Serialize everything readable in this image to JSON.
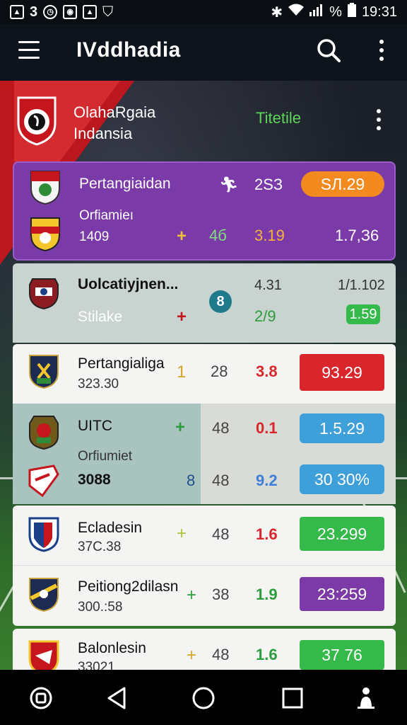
{
  "status_bar": {
    "left_icons": [
      "photo-icon",
      "3",
      "clock-icon",
      "camera-icon",
      "photo-icon",
      "shield-icon"
    ],
    "battery_text": "%",
    "time": "19:31"
  },
  "app_bar": {
    "title": "IVddhadia"
  },
  "league": {
    "name_line1": "OlahaRgaia",
    "name_line2": "Indansia",
    "action": "Titetile"
  },
  "matches": [
    {
      "team1": "Pertangiaidan",
      "team2_name": "Orfiamieı",
      "team2_sub": "1409",
      "icon_top": "running-icon",
      "col_a_top": "2ЅЗ",
      "pill_top": "ЅЛ.29",
      "plus": "+",
      "col_b": "4б",
      "col_c": "3.19",
      "col_d": "1.7,З6"
    },
    {
      "team1": "Uolcatiyjnen...",
      "team2": "Stilake",
      "badge": "8",
      "plus": "+",
      "col_a_top": "4.31",
      "col_b_top": "1/1.102",
      "col_a": "2/9",
      "pill": "1.59"
    },
    {
      "team": "Pertangialiga",
      "sub": "323.30",
      "plus": "1",
      "col_a": "28",
      "col_b": "3.8",
      "pill": "93.29"
    },
    {
      "team": "UITC",
      "plus": "+",
      "col_a": "48",
      "col_b": "0.1",
      "pill": "1.5.29",
      "team2": "Orfiumiet",
      "team2_sub": "3088",
      "plus2": "8",
      "col_a2": "48",
      "col_b2": "9.2",
      "pill2": "30 30%"
    },
    {
      "team": "Ecladesin",
      "sub": "37Ϲ.38",
      "plus": "+",
      "col_a": "48",
      "col_b": "1.6",
      "pill": "23.299"
    },
    {
      "team": "Peitiong2dilasn",
      "sub": "300.:58",
      "plus": "+",
      "col_a": "38",
      "col_b": "1.9",
      "pill": "23:259"
    },
    {
      "team": "Balonlesin",
      "sub": "33021",
      "plus": "+",
      "col_a": "48",
      "col_b": "1.6",
      "pill": "37 76"
    }
  ],
  "colors": {
    "purple": "#7a3aa8",
    "orange": "#f28a1f",
    "red": "#d8262c",
    "blue": "#3f9fd9",
    "green": "#34b94a",
    "violet": "#7b3aa5"
  }
}
